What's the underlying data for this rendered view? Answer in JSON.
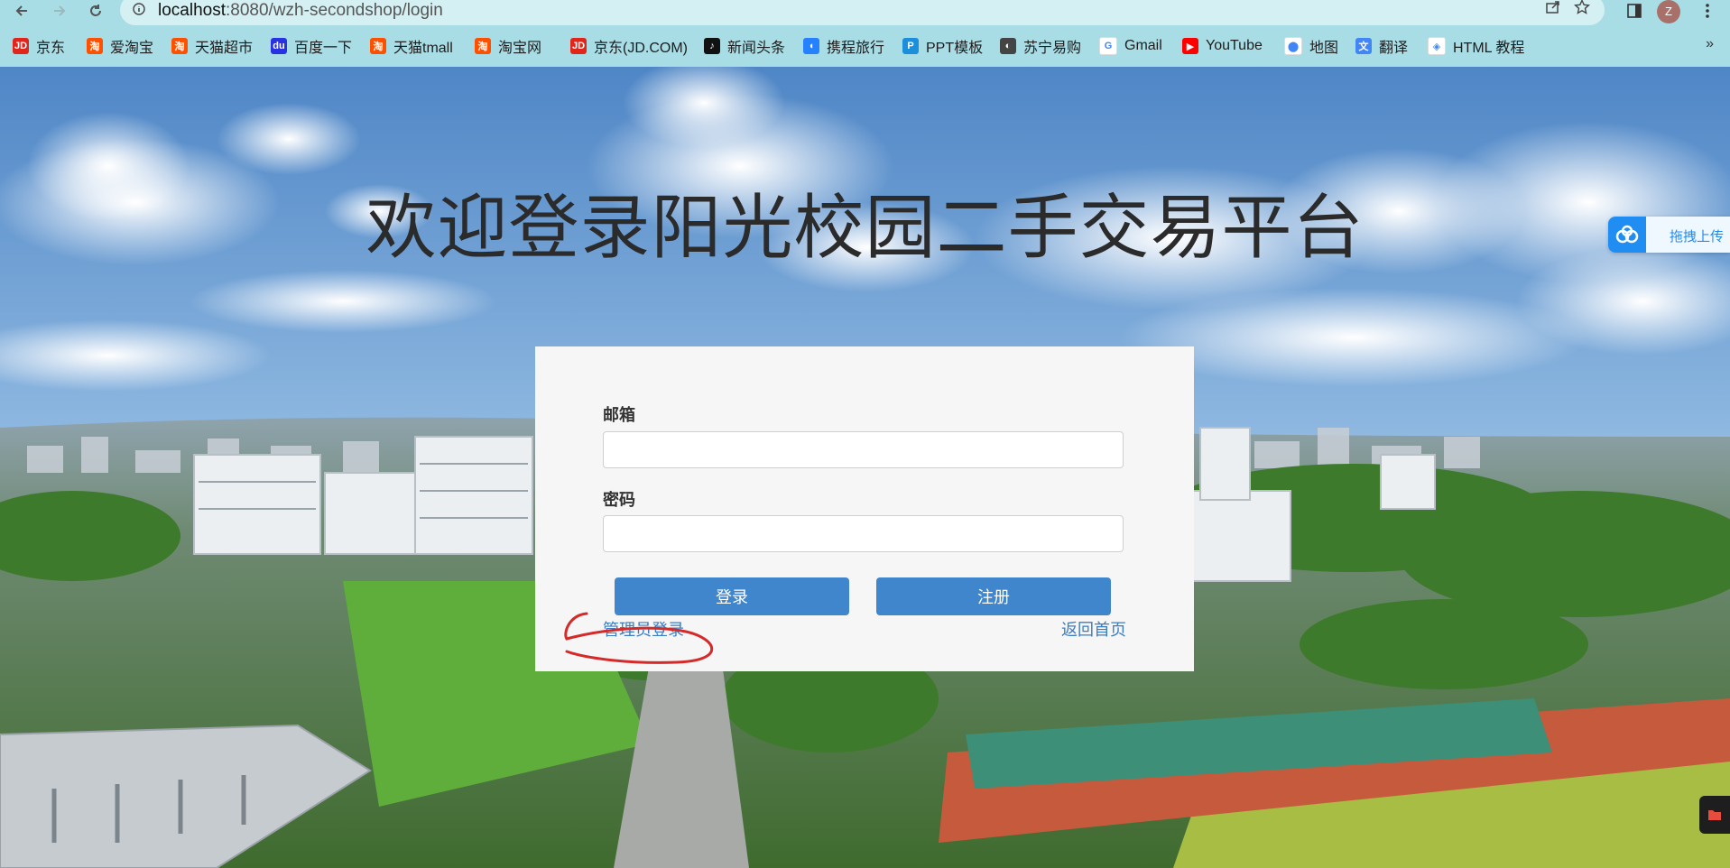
{
  "browser": {
    "url_host": "localhost",
    "url_path": ":8080/wzh-secondshop/login",
    "avatar_letter": "Z"
  },
  "bookmarks": [
    {
      "label": "京东",
      "icon": "jd-icon",
      "color": "#e1251b",
      "glyph": "JD"
    },
    {
      "label": "爱淘宝",
      "icon": "taobao-icon",
      "color": "#ff5000",
      "glyph": "淘"
    },
    {
      "label": "天猫超市",
      "icon": "taobao-icon",
      "color": "#ff5000",
      "glyph": "淘"
    },
    {
      "label": "百度一下",
      "icon": "baidu-icon",
      "color": "#2932e1",
      "glyph": "du"
    },
    {
      "label": "天猫tmall",
      "icon": "taobao-icon",
      "color": "#ff5000",
      "glyph": "淘"
    },
    {
      "label": "淘宝网",
      "icon": "taobao-icon",
      "color": "#ff5000",
      "glyph": "淘"
    },
    {
      "label": "京东(JD.COM)",
      "icon": "jd-icon",
      "color": "#e1251b",
      "glyph": "JD"
    },
    {
      "label": "新闻头条",
      "icon": "tiktok-icon",
      "color": "#111111",
      "glyph": "♪"
    },
    {
      "label": "携程旅行",
      "icon": "ctrip-icon",
      "color": "#2681ff",
      "glyph": "◖"
    },
    {
      "label": "PPT模板",
      "icon": "ppt-icon",
      "color": "#1c8fdc",
      "glyph": "P"
    },
    {
      "label": "苏宁易购",
      "icon": "globe-icon",
      "color": "#444444",
      "glyph": "◐"
    },
    {
      "label": "Gmail",
      "icon": "google-icon",
      "color": "#ffffff",
      "glyph": "G"
    },
    {
      "label": "YouTube",
      "icon": "youtube-icon",
      "color": "#ff0000",
      "glyph": "▶"
    },
    {
      "label": "地图",
      "icon": "maps-icon",
      "color": "#ffffff",
      "glyph": "⬤"
    },
    {
      "label": "翻译",
      "icon": "translate-icon",
      "color": "#4285f4",
      "glyph": "文"
    },
    {
      "label": "HTML 教程",
      "icon": "runoob-icon",
      "color": "#ffffff",
      "glyph": "◈"
    }
  ],
  "page": {
    "headline": "欢迎登录阳光校园二手交易平台",
    "email_label": "邮箱",
    "email_value": "",
    "password_label": "密码",
    "password_value": "",
    "login_button": "登录",
    "register_button": "注册",
    "admin_link": "管理员登录",
    "home_link": "返回首页"
  },
  "widgets": {
    "upload_label": "拖拽上传"
  },
  "colors": {
    "primary_button": "#3f86cc",
    "link": "#3c7cc4",
    "annotation": "#d42a2a"
  }
}
